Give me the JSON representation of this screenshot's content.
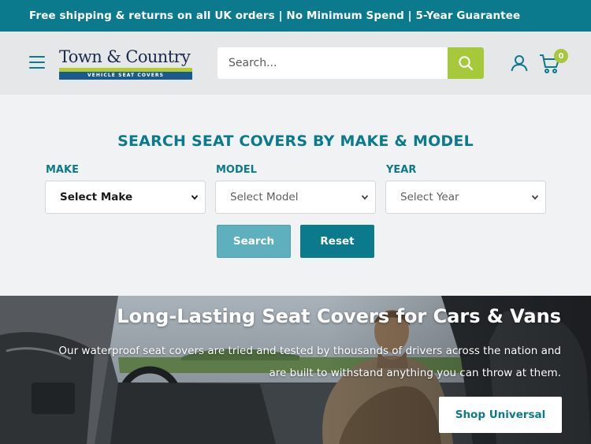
{
  "announcement": {
    "text": "Free shipping & returns on all UK orders | No Minimum Spend | 5-Year Guarantee"
  },
  "header": {
    "menu_icon": "hamburger-menu-icon",
    "logo": {
      "name": "Town & Country",
      "tagline": "VEHICLE SEAT COVERS"
    },
    "search": {
      "placeholder": "Search...",
      "button_icon": "search-icon"
    },
    "account_icon": "user-icon",
    "cart": {
      "icon": "cart-icon",
      "count": "0"
    }
  },
  "finder": {
    "title": "SEARCH SEAT COVERS BY MAKE & MODEL",
    "fields": [
      {
        "label": "MAKE",
        "selected": "Select Make",
        "enabled": true
      },
      {
        "label": "MODEL",
        "selected": "Select Model",
        "enabled": false
      },
      {
        "label": "YEAR",
        "selected": "Select Year",
        "enabled": false
      }
    ],
    "search_label": "Search",
    "reset_label": "Reset"
  },
  "hero": {
    "title": "Long-Lasting Seat Covers for Cars & Vans",
    "subtitle": "Our waterproof seat covers are tried and tested by thousands of drivers across the nation and are built to withstand anything you can throw at them.",
    "cta_label": "Shop Universal"
  },
  "colors": {
    "primary": "#0a7a8c",
    "accent": "#a5c93a",
    "header_bg": "#e6e7e9",
    "page_bg": "#f1f2f4"
  }
}
